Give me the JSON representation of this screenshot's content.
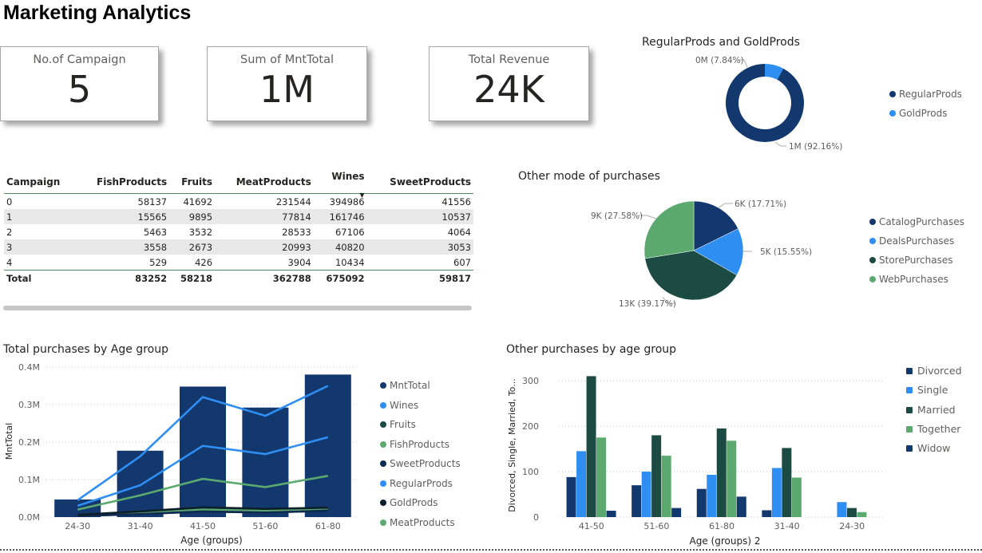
{
  "page_title": "Marketing Analytics",
  "cards": [
    {
      "label": "No.of Campaign",
      "value": "5"
    },
    {
      "label": "Sum of MntTotal",
      "value": "1M"
    },
    {
      "label": "Total Revenue",
      "value": "24K"
    }
  ],
  "donut": {
    "title": "RegularProds and GoldProds",
    "slices": [
      {
        "name": "RegularProds",
        "label": "1M (92.16%)",
        "percent": 92.16,
        "color": "#12386e"
      },
      {
        "name": "GoldProds",
        "label": "0M (7.84%)",
        "percent": 7.84,
        "color": "#2e8ef2"
      }
    ]
  },
  "pie": {
    "title": "Other mode of purchases",
    "slices": [
      {
        "name": "CatalogPurchases",
        "label": "6K (17.71%)",
        "percent": 17.71,
        "color": "#12386e"
      },
      {
        "name": "DealsPurchases",
        "label": "5K (15.55%)",
        "percent": 15.55,
        "color": "#2e8ef2"
      },
      {
        "name": "StorePurchases",
        "label": "13K (39.17%)",
        "percent": 39.17,
        "color": "#1b4b42"
      },
      {
        "name": "WebPurchases",
        "label": "9K (27.58%)",
        "percent": 27.58,
        "color": "#5ca96f"
      }
    ]
  },
  "table": {
    "columns": [
      "Campaign",
      "FishProducts",
      "Fruits",
      "MeatProducts",
      "Wines",
      "SweetProducts"
    ],
    "rows": [
      [
        "0",
        "58137",
        "41692",
        "231544",
        "394986",
        "41556"
      ],
      [
        "1",
        "15565",
        "9895",
        "77814",
        "161746",
        "10537"
      ],
      [
        "2",
        "5463",
        "3532",
        "28533",
        "67106",
        "4064"
      ],
      [
        "3",
        "3558",
        "2673",
        "20993",
        "40820",
        "3053"
      ],
      [
        "4",
        "529",
        "426",
        "3904",
        "10434",
        "607"
      ]
    ],
    "total": [
      "Total",
      "83252",
      "58218",
      "362788",
      "675092",
      "59817"
    ],
    "sort_glyph": "▼"
  },
  "chart_data": [
    {
      "type": "bar",
      "title": "Total purchases by Age group",
      "xlabel": "Age (groups)",
      "ylabel": "MntTotal",
      "categories": [
        "24-30",
        "31-40",
        "41-50",
        "51-60",
        "61-80"
      ],
      "yticks": [
        "0.0M",
        "0.1M",
        "0.2M",
        "0.3M",
        "0.4M"
      ],
      "ylim": [
        0,
        400000
      ],
      "grid": true,
      "legend_position": "right",
      "series": [
        {
          "name": "MntTotal",
          "kind": "bar",
          "color": "#12386e",
          "values": [
            47000,
            177000,
            348000,
            292000,
            380000
          ]
        },
        {
          "name": "Wines",
          "kind": "line",
          "color": "#2e8ef2",
          "values": [
            45000,
            162000,
            320000,
            270000,
            350000
          ]
        },
        {
          "name": "Fruits",
          "kind": "line",
          "color": "#1b4b42",
          "values": [
            3000,
            8000,
            15000,
            12000,
            17000
          ]
        },
        {
          "name": "FishProducts",
          "kind": "line",
          "color": "#5ca96f",
          "values": [
            5000,
            11000,
            20000,
            17000,
            23000
          ]
        },
        {
          "name": "SweetProducts",
          "kind": "line",
          "color": "#0f2a52",
          "values": [
            3000,
            8000,
            15000,
            12000,
            17000
          ]
        },
        {
          "name": "RegularProds",
          "kind": "line",
          "color": "#2e8ef2",
          "values": [
            30000,
            85000,
            190000,
            168000,
            213000
          ]
        },
        {
          "name": "GoldProds",
          "kind": "line",
          "color": "#0c1f2b",
          "values": [
            6000,
            15000,
            26000,
            22000,
            25000
          ]
        },
        {
          "name": "MeatProducts",
          "kind": "line",
          "color": "#5ca96f",
          "values": [
            20000,
            58000,
            102000,
            80000,
            110000
          ]
        }
      ]
    },
    {
      "type": "bar",
      "title": "Other purchases by age group",
      "xlabel": "Age (groups) 2",
      "ylabel": "Divorced, Single, Married, To...",
      "categories": [
        "41-50",
        "51-60",
        "61-80",
        "31-40",
        "24-30"
      ],
      "yticks": [
        "0",
        "100",
        "200",
        "300"
      ],
      "ylim": [
        0,
        330
      ],
      "grid": true,
      "legend_position": "right",
      "series": [
        {
          "name": "Divorced",
          "color": "#12386e",
          "values": [
            88,
            70,
            62,
            15,
            0
          ]
        },
        {
          "name": "Single",
          "color": "#2e8ef2",
          "values": [
            145,
            100,
            93,
            108,
            33
          ]
        },
        {
          "name": "Married",
          "color": "#1b4b42",
          "values": [
            310,
            180,
            195,
            152,
            20
          ]
        },
        {
          "name": "Together",
          "color": "#5ca96f",
          "values": [
            175,
            135,
            168,
            87,
            11
          ]
        },
        {
          "name": "Widow",
          "color": "#12386e",
          "values": [
            14,
            20,
            45,
            0,
            0
          ]
        }
      ]
    }
  ]
}
